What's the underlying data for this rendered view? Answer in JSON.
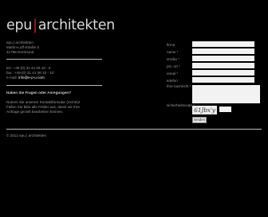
{
  "brand": {
    "left": "epu",
    "separator": "|",
    "right": "architekten"
  },
  "address": {
    "line1": "epu | architekten",
    "line2": "Martin-Luff-Straße 5",
    "line3": "41796 Dortmund"
  },
  "contact": {
    "tel": "tel.: +49 (0) 31 41 06 10 - 5",
    "fax": "fax.: +49 (0) 31 41 06 10 - 10",
    "email_label": "e-mail: ",
    "email": "info@e-p-u.com"
  },
  "questions": {
    "title": "Haben Sie Fragen oder Anregungen?",
    "text1": "Nutzen Sie unseren Kontaktformular (rechts)!",
    "text2": "Füllen Sie bitte alle Felder aus, damit wir Ihre",
    "text3": "Anfrage gezielt bearbeiten können."
  },
  "footer": {
    "copyright": "© 2012 epu | architekten"
  },
  "form": {
    "labels": {
      "firma": "firma",
      "name": "name *",
      "strasse": "straße *",
      "plz": "plz, ort *",
      "email": "email *",
      "telefon": "telefon",
      "nachricht": "ihre nachricht *",
      "sicherheitscode": "sicherheitscode *"
    },
    "captcha_text": "61Jbx'y",
    "submit_label": "senden"
  }
}
